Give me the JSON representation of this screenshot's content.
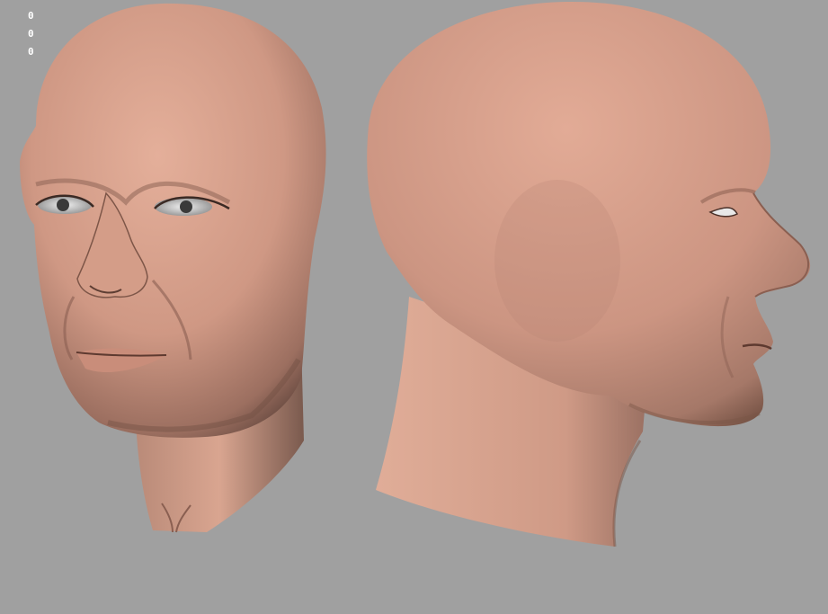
{
  "viewport": {
    "background_color": "#a0a0a0"
  },
  "hud": {
    "stats": [
      "0",
      "0",
      "0"
    ]
  },
  "models": [
    {
      "label": "head-front-three-quarter-view",
      "skin_color": "#d9a08c"
    },
    {
      "label": "head-side-profile-view",
      "skin_color": "#d9a08c"
    }
  ]
}
